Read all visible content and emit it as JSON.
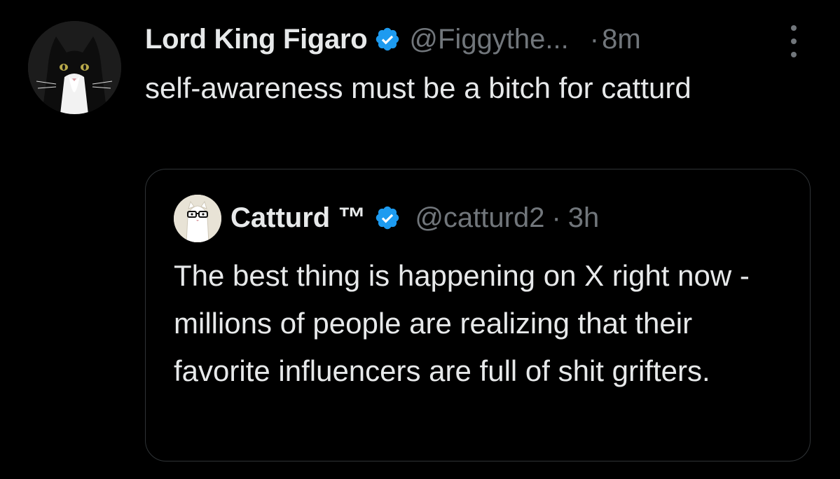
{
  "tweet": {
    "author": {
      "display_name": "Lord King Figaro",
      "handle": "@Figgythe...",
      "verified": true,
      "avatar": "cat-avatar"
    },
    "separator": "·",
    "timestamp": "8m",
    "more_icon": "more-vertical-icon",
    "text": "self-awareness must be a bitch for catturd",
    "quoted": {
      "author": {
        "display_name": "Catturd ™",
        "handle": "@catturd2",
        "verified": true,
        "avatar": "catturd-avatar"
      },
      "separator": "·",
      "timestamp": "3h",
      "text": "The best thing is happening on X right now - millions of people are realizing that their favorite influencers are full of shit grifters."
    }
  },
  "colors": {
    "background": "#000000",
    "primary_text": "#e7e9ea",
    "secondary_text": "#71767b",
    "verified_blue": "#1d9bf0",
    "border": "#2f3336"
  }
}
